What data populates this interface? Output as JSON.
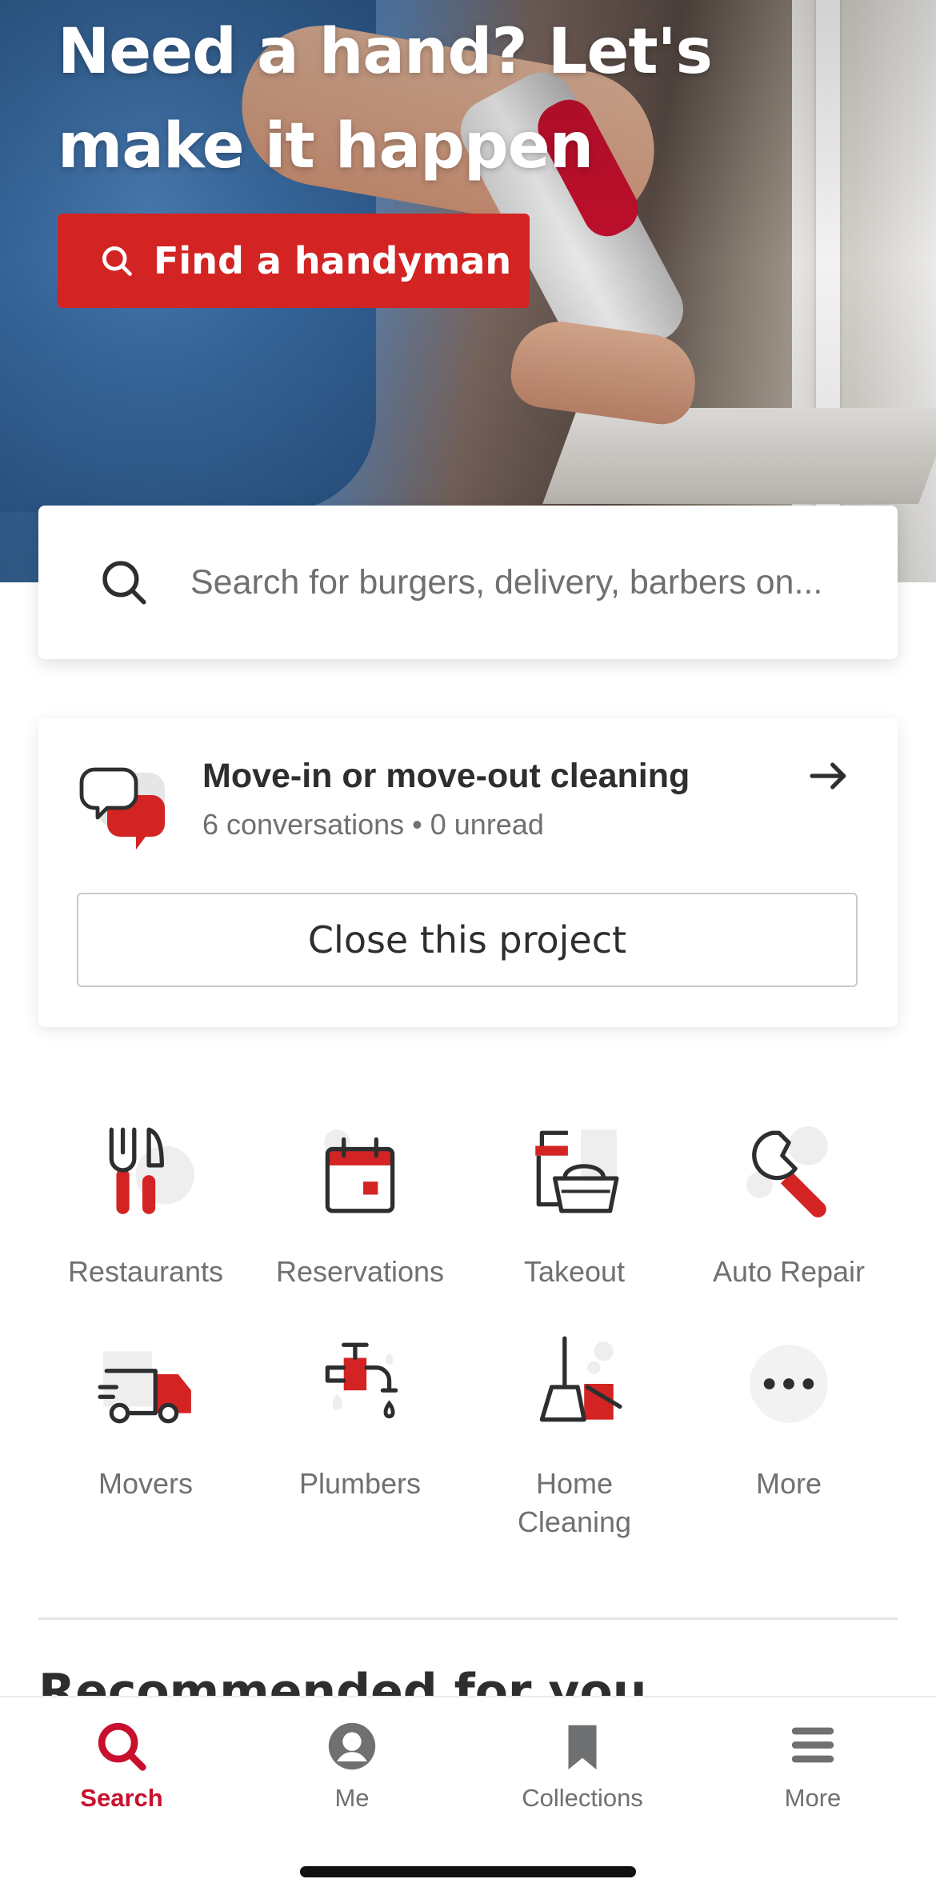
{
  "hero": {
    "title": "Need a hand? Let's make it happen",
    "button_label": "Find a handyman"
  },
  "search": {
    "placeholder": "Search for burgers, delivery, barbers on..."
  },
  "project": {
    "title": "Move-in or move-out cleaning",
    "subtitle": "6 conversations • 0 unread",
    "close_label": "Close this project"
  },
  "categories": [
    {
      "label": "Restaurants",
      "icon": "fork-knife-icon"
    },
    {
      "label": "Reservations",
      "icon": "calendar-icon"
    },
    {
      "label": "Takeout",
      "icon": "takeout-basket-icon"
    },
    {
      "label": "Auto Repair",
      "icon": "wrench-icon"
    },
    {
      "label": "Movers",
      "icon": "truck-icon"
    },
    {
      "label": "Plumbers",
      "icon": "faucet-icon"
    },
    {
      "label": "Home Cleaning",
      "icon": "broom-icon"
    },
    {
      "label": "More",
      "icon": "more-dots-icon"
    }
  ],
  "recommended": {
    "title": "Recommended for you"
  },
  "tabbar": {
    "items": [
      {
        "label": "Search",
        "icon": "search-icon",
        "active": true
      },
      {
        "label": "Me",
        "icon": "profile-icon",
        "active": false
      },
      {
        "label": "Collections",
        "icon": "bookmark-icon",
        "active": false
      },
      {
        "label": "More",
        "icon": "menu-icon",
        "active": false
      }
    ]
  },
  "colors": {
    "brand_red": "#d32323",
    "active_red": "#c8102e",
    "text_dark": "#2d2e2f",
    "text_gray": "#6e7072"
  }
}
